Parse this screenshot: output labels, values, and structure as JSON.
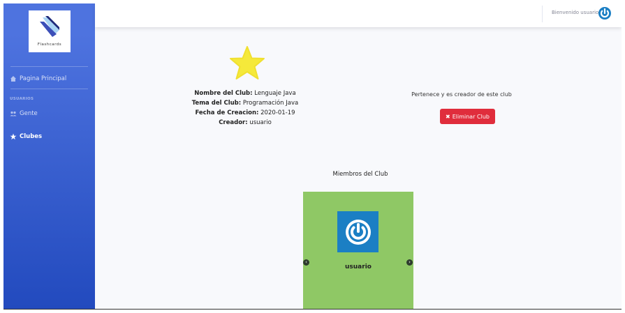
{
  "brand": {
    "text": "Flashcards"
  },
  "sidebar": {
    "home_label": "Pagina Principal",
    "heading": "USUARIOS",
    "people_label": "Gente",
    "clubs_label": "Clubes"
  },
  "topbar": {
    "welcome": "Bienvenido usuario"
  },
  "club": {
    "name_label": "Nombre del Club:",
    "name_value": "Lenguaje Java",
    "topic_label": "Tema del Club:",
    "topic_value": "Programación Java",
    "date_label": "Fecha de Creacion:",
    "date_value": "2020-01-19",
    "creator_label": "Creador:",
    "creator_value": "usuario"
  },
  "status": {
    "belongs_text": "Pertenece y es creador de este club"
  },
  "actions": {
    "delete_label": "Eliminar Club"
  },
  "members": {
    "title": "Miembros del Club",
    "items": [
      {
        "name": "usuario"
      }
    ]
  },
  "colors": {
    "sidebar": "#4e73df",
    "danger": "#e02d3c",
    "card": "#8fc865",
    "star": "#f5e93a",
    "avatar": "#1b7fc4"
  }
}
